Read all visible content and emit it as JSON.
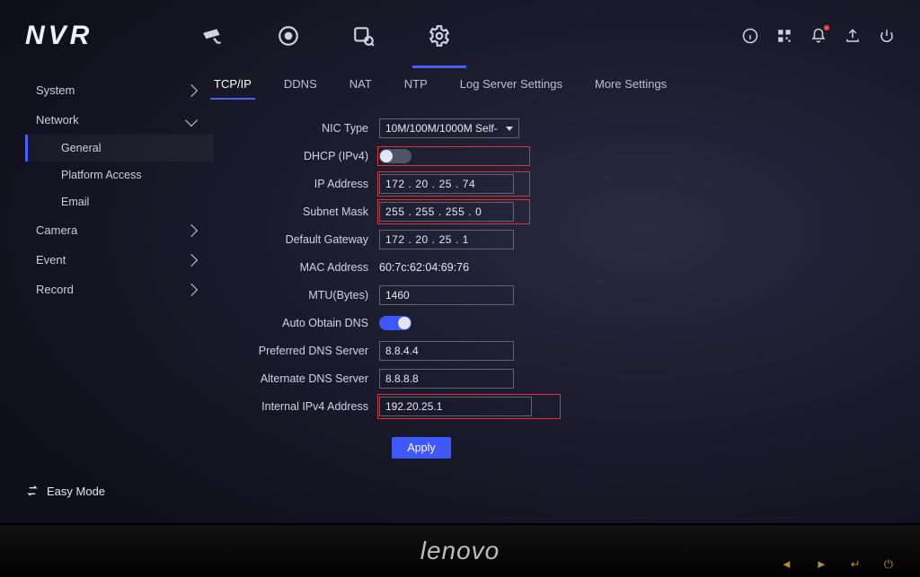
{
  "logo": "NVR",
  "tabs": [
    "TCP/IP",
    "DDNS",
    "NAT",
    "NTP",
    "Log Server Settings",
    "More Settings"
  ],
  "active_tab_index": 0,
  "sidebar": {
    "items": [
      {
        "label": "System",
        "expanded": false
      },
      {
        "label": "Network",
        "expanded": true,
        "children": [
          "General",
          "Platform Access",
          "Email"
        ]
      },
      {
        "label": "Camera",
        "expanded": false
      },
      {
        "label": "Event",
        "expanded": false
      },
      {
        "label": "Record",
        "expanded": false
      }
    ],
    "active_child": "General"
  },
  "form": {
    "nic_type": {
      "label": "NIC Type",
      "value": "10M/100M/1000M Self-"
    },
    "dhcp": {
      "label": "DHCP (IPv4)",
      "on": false
    },
    "ip": {
      "label": "IP Address",
      "parts": [
        "172",
        "20",
        "25",
        "74"
      ]
    },
    "mask": {
      "label": "Subnet Mask",
      "parts": [
        "255",
        "255",
        "255",
        "0"
      ]
    },
    "gw": {
      "label": "Default Gateway",
      "parts": [
        "172",
        "20",
        "25",
        "1"
      ]
    },
    "mac": {
      "label": "MAC Address",
      "value": "60:7c:62:04:69:76"
    },
    "mtu": {
      "label": "MTU(Bytes)",
      "value": "1460"
    },
    "autodns": {
      "label": "Auto Obtain DNS",
      "on": true
    },
    "dns1": {
      "label": "Preferred DNS Server",
      "value": "8.8.4.4"
    },
    "dns2": {
      "label": "Alternate DNS Server",
      "value": "8.8.8.8"
    },
    "internal": {
      "label": "Internal IPv4 Address",
      "value": "192.20.25.1"
    },
    "apply": "Apply"
  },
  "footer": {
    "label": "Easy Mode"
  },
  "monitor_brand": "lenovo"
}
